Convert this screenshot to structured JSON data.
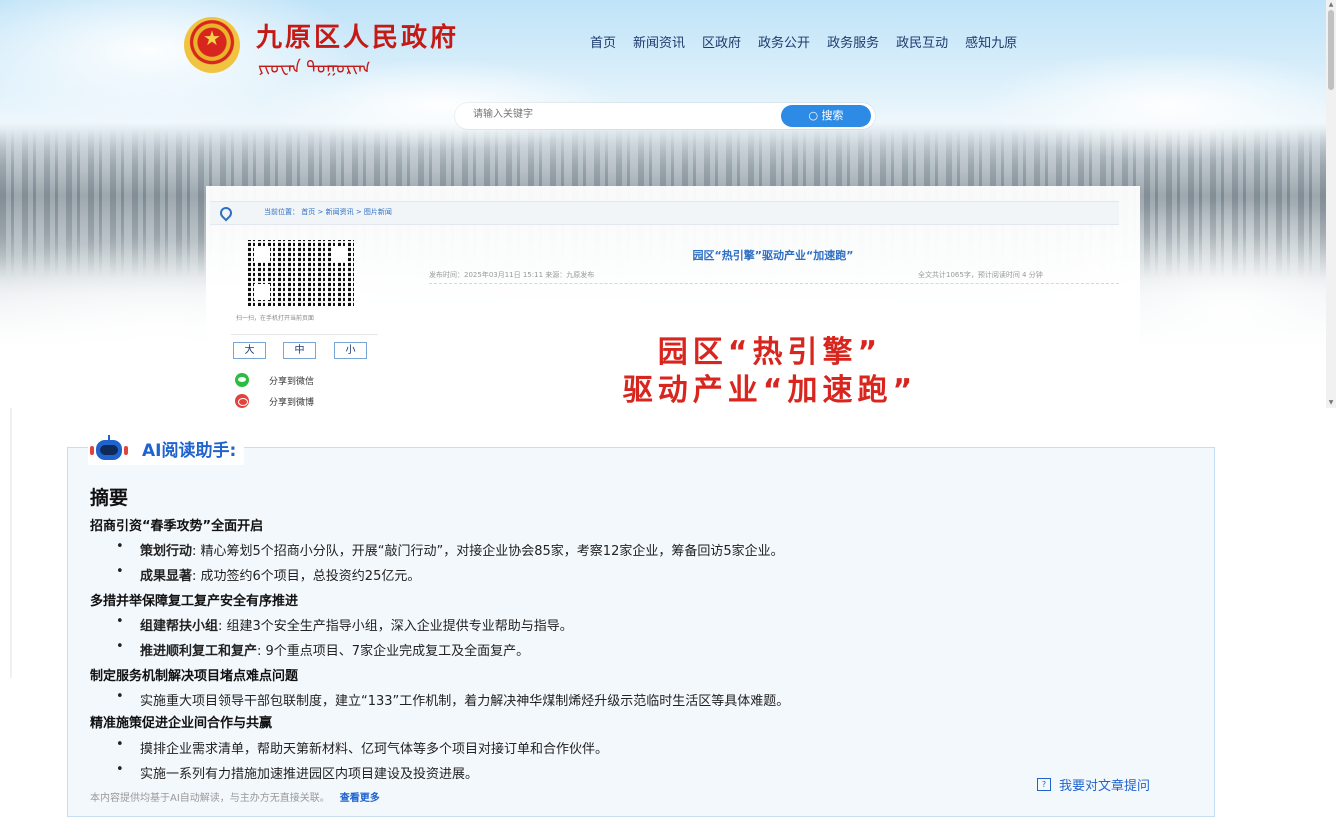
{
  "header": {
    "site_title": "九原区人民政府",
    "mongolian_script": "ᠶᠢᠦᠸᠠᠨ ᠳᠣᠭᠣᠷᠢᠭ",
    "nav": [
      "首页",
      "新闻资讯",
      "区政府",
      "政务公开",
      "政务服务",
      "政民互动",
      "感知九原"
    ]
  },
  "search": {
    "placeholder": "请输入关键字",
    "button": "搜索",
    "icon": "magnifier-icon"
  },
  "breadcrumb": {
    "prefix": "当前位置：",
    "items": [
      "首页",
      "新闻资讯",
      "图片新闻"
    ],
    "separator": ">"
  },
  "sidebar": {
    "qr_caption": "扫一扫，在手机打开当前页面",
    "font_sizes": [
      "大",
      "中",
      "小"
    ],
    "share": [
      {
        "label": "分享到微信",
        "icon": "wechat-icon",
        "color": "#2bbd40"
      },
      {
        "label": "分享到微博",
        "icon": "weibo-icon",
        "color": "#e2443d"
      }
    ]
  },
  "article": {
    "title": "园区“热引擎”驱动产业“加速跑”",
    "meta_left": "发布时间：2025年03月11日 15:11    来源：九原发布",
    "meta_right": "全文共计1065字，预计阅读时间 4 分钟",
    "banner_line1": "园区“热引擎”",
    "banner_line2": "驱动产业“加速跑”"
  },
  "ai": {
    "title": "AI阅读助手:",
    "summary_heading": "摘要",
    "sections": [
      {
        "heading": "招商引资“春季攻势”全面开启",
        "bullets": [
          {
            "bold": "策划行动",
            "text": ": 精心筹划5个招商小分队，开展“敲门行动”，对接企业协会85家，考察12家企业，筹备回访5家企业。"
          },
          {
            "bold": "成果显著",
            "text": ": 成功签约6个项目，总投资约25亿元。"
          }
        ]
      },
      {
        "heading": "多措并举保障复工复产安全有序推进",
        "bullets": [
          {
            "bold": "组建帮扶小组",
            "text": ": 组建3个安全生产指导小组，深入企业提供专业帮助与指导。"
          },
          {
            "bold": "推进顺利复工和复产",
            "text": ": 9个重点项目、7家企业完成复工及全面复产。"
          }
        ]
      },
      {
        "heading": "制定服务机制解决项目堵点难点问题",
        "bullets": [
          {
            "bold": "",
            "text": "实施重大项目领导干部包联制度，建立“133”工作机制，着力解决神华煤制烯烃升级示范临时生活区等具体难题。"
          }
        ]
      },
      {
        "heading": "精准施策促进企业间合作与共赢",
        "bullets": [
          {
            "bold": "",
            "text": "摸排企业需求清单，帮助天第新材料、亿珂气体等多个项目对接订单和合作伙伴。"
          },
          {
            "bold": "",
            "text": "实施一系列有力措施加速推进园区内项目建设及投资进展。"
          }
        ]
      }
    ],
    "disclaimer": "本内容提供均基于AI自动解读，与主办方无直接关联。",
    "more_link": "查看更多",
    "ask_label": "我要对文章提问"
  },
  "colors": {
    "brand_red": "#d8261f",
    "link_blue": "#1f63cf",
    "search_button": "#2d8be6"
  }
}
